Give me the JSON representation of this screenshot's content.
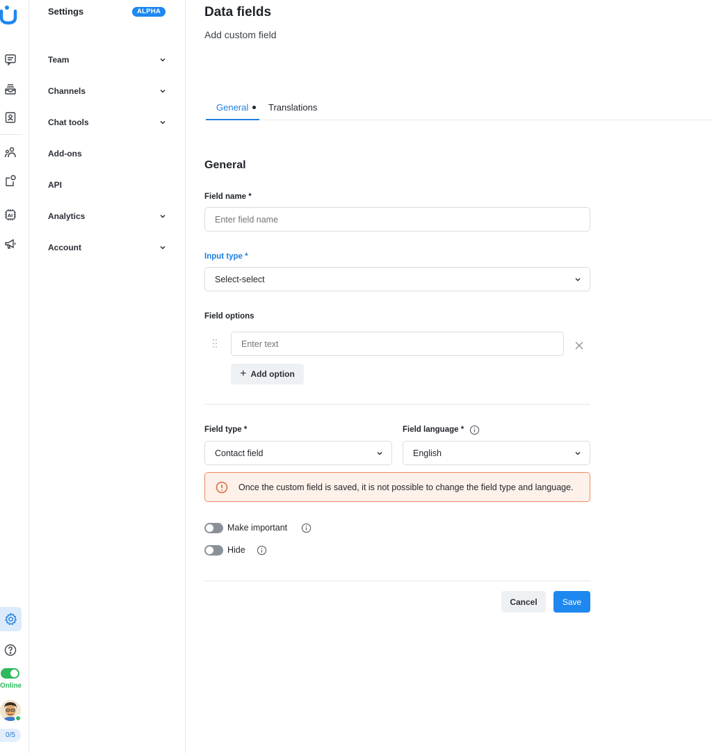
{
  "colors": {
    "accent": "#1e88f0",
    "online": "#2fb95e",
    "warning_border": "#ec8b5c",
    "warning_bg": "#fdf1ea"
  },
  "rail": {
    "icons": [
      "logo-icon",
      "chat-icon",
      "inbox-icon",
      "contacts-icon",
      "team-icon",
      "integrations-icon",
      "ai-icon",
      "campaigns-icon",
      "settings-icon",
      "help-icon"
    ],
    "status_label": "Online",
    "counter": "0/5"
  },
  "sidebar": {
    "title": "Settings",
    "badge": "ALPHA",
    "items": [
      {
        "label": "Team",
        "expandable": true
      },
      {
        "label": "Channels",
        "expandable": true
      },
      {
        "label": "Chat tools",
        "expandable": true
      },
      {
        "label": "Add-ons",
        "expandable": false
      },
      {
        "label": "API",
        "expandable": false
      },
      {
        "label": "Analytics",
        "expandable": true
      },
      {
        "label": "Account",
        "expandable": true
      }
    ]
  },
  "main": {
    "title": "Data fields",
    "subtitle": "Add custom field",
    "tabs": [
      {
        "label": "General",
        "active": true,
        "has_dot": true
      },
      {
        "label": "Translations",
        "active": false
      }
    ],
    "section_title": "General",
    "field_name": {
      "label": "Field name *",
      "placeholder": "Enter field name",
      "value": ""
    },
    "input_type": {
      "label": "Input type *",
      "value": "Select-select"
    },
    "field_options": {
      "label": "Field options",
      "placeholder": "Enter text",
      "add_label": "Add option"
    },
    "field_type": {
      "label": "Field type *",
      "value": "Contact field"
    },
    "field_language": {
      "label": "Field language *",
      "value": "English"
    },
    "warning": "Once the custom field is saved, it is not possible to change the field type and language.",
    "toggles": [
      {
        "label": "Make important",
        "on": false
      },
      {
        "label": "Hide",
        "on": false
      }
    ],
    "cancel_label": "Cancel",
    "save_label": "Save"
  }
}
